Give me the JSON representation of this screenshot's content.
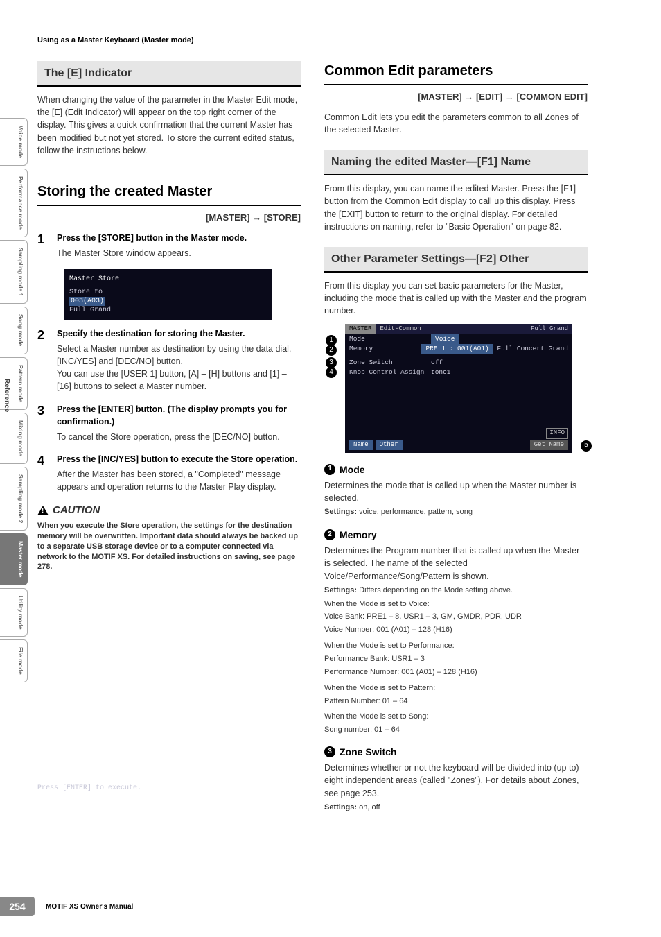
{
  "header": {
    "path": "Using as a Master Keyboard (Master mode)"
  },
  "sideTabs": {
    "items": [
      "Voice mode",
      "Performance mode",
      "Sampling mode 1",
      "Song mode",
      "Pattern mode",
      "Mixing mode",
      "Sampling mode 2",
      "Master mode",
      "Utility mode",
      "File mode"
    ],
    "refLabel": "Reference"
  },
  "left": {
    "box1": {
      "title": "The [E] Indicator",
      "body": "When changing the value of the parameter in the Master Edit mode, the [E] (Edit Indicator) will appear on the top right corner of the display. This gives a quick confirmation that the current Master has been modified but not yet stored. To store the current edited status, follow the instructions below."
    },
    "section": {
      "title": "Storing the created Master",
      "path": "[MASTER] → [STORE]"
    },
    "steps": [
      {
        "title": "Press the [STORE] button in the Master mode.",
        "body": "The Master Store window appears."
      },
      {
        "title": "Specify the destination for storing the Master.",
        "body1": "Select a Master number as destination by using the data dial, [INC/YES] and [DEC/NO] button.",
        "body2": "You can use the [USER 1] button, [A] – [H] buttons and [1] – [16] buttons to select a Master number."
      },
      {
        "title": "Press the [ENTER] button. (The display prompts you for confirmation.)",
        "body": "To cancel the Store operation, press the [DEC/NO] button."
      },
      {
        "title": "Press the [INC/YES] button to execute the Store operation.",
        "body": "After the Master has been stored, a \"Completed\" message appears and operation returns to the Master Play display."
      }
    ],
    "shot1": {
      "title": "Master Store",
      "l1": "Store to",
      "l2": "003(A03)",
      "l3": "Full Grand",
      "footer": "Press [ENTER] to execute."
    },
    "caution": {
      "label": "CAUTION",
      "body": "When you execute the Store operation, the settings for the destination memory will be overwritten. Important data should always be backed up to a separate USB storage device or to a computer connected via network to the MOTIF XS. For detailed instructions on saving, see page 278."
    }
  },
  "right": {
    "section": {
      "title": "Common Edit parameters",
      "path": "[MASTER] → [EDIT] → [COMMON EDIT]",
      "intro": "Common Edit lets you edit the parameters common to all Zones of the selected Master."
    },
    "box1": {
      "title": "Naming the edited Master—[F1] Name",
      "body": "From this display, you can name the edited Master. Press the [F1] button from the Common Edit display to call up this display. Press the [EXIT] button to return to the original display. For detailed instructions on naming, refer to \"Basic Operation\" on page 82."
    },
    "box2": {
      "title": "Other Parameter Settings—[F2] Other",
      "body": "From this display you can set basic parameters for the Master, including the mode that is called up with the Master and the program number."
    },
    "shot2": {
      "tab1": "MASTER",
      "tab2": "Edit-Common",
      "right": "Full Grand",
      "r1l": "Mode",
      "r1v": "Voice",
      "r2l": "Memory",
      "r2v1": "PRE 1 : 001(A01)",
      "r2v2": "Full Concert Grand",
      "r3l": "Zone Switch",
      "r3v": "off",
      "r4l": "Knob Control Assign",
      "r4v": "tone1",
      "info": "INFO",
      "b1": "Name",
      "b2": "Other",
      "b3": "Get Name"
    },
    "params": {
      "p1": {
        "num": "1",
        "name": "Mode",
        "body": "Determines the mode that is called up when the Master number is selected.",
        "settings": "voice, performance, pattern, song"
      },
      "p2": {
        "num": "2",
        "name": "Memory",
        "body": "Determines the Program number that is called up when the Master is selected. The name of the selected Voice/Performance/Song/Pattern is shown.",
        "settings": "Differs depending on the Mode setting above.",
        "v1a": "When the Mode is set to Voice:",
        "v1b": "Voice Bank: PRE1 – 8, USR1 – 3, GM, GMDR, PDR, UDR",
        "v1c": "Voice Number: 001 (A01) – 128 (H16)",
        "v2a": "When the Mode is set to Performance:",
        "v2b": "Performance Bank: USR1 – 3",
        "v2c": "Performance Number: 001 (A01) – 128 (H16)",
        "v3a": "When the Mode is set to Pattern:",
        "v3b": "Pattern Number: 01 – 64",
        "v4a": "When the Mode is set to Song:",
        "v4b": "Song number: 01 – 64"
      },
      "p3": {
        "num": "3",
        "name": "Zone Switch",
        "body": "Determines whether or not the keyboard will be divided into (up to) eight independent areas (called \"Zones\"). For details about Zones, see page 253.",
        "settings": "on, off"
      }
    }
  },
  "footer": {
    "page": "254",
    "manual": "MOTIF XS Owner's Manual"
  }
}
